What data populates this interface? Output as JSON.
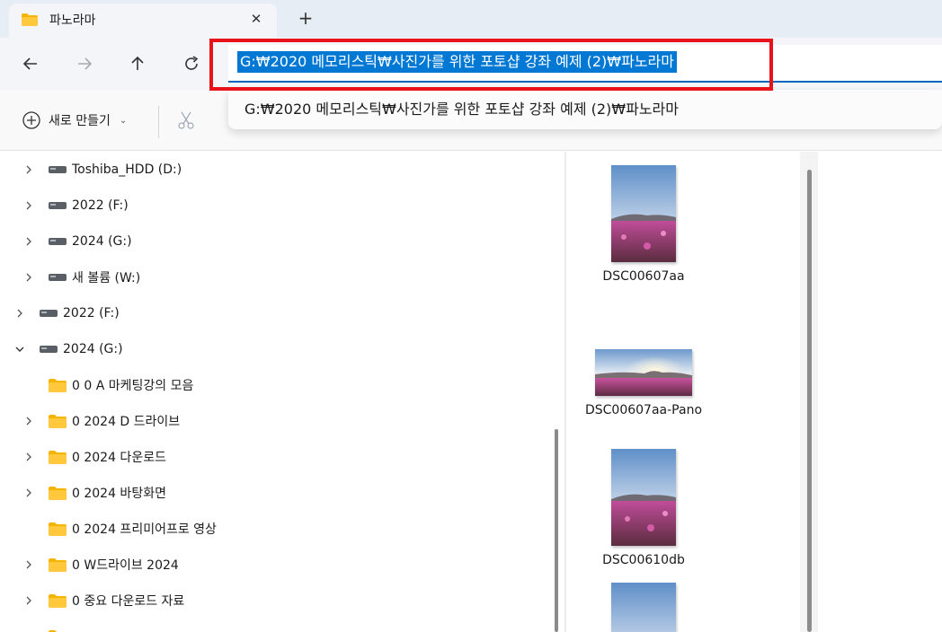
{
  "tab": {
    "title": "파노라마",
    "close_icon": "close-icon",
    "new_tab_icon": "plus-icon"
  },
  "nav": {
    "back_icon": "arrow-left-icon",
    "forward_icon": "arrow-right-icon",
    "up_icon": "arrow-up-icon",
    "refresh_icon": "refresh-icon"
  },
  "address": {
    "value": "G:₩2020 메모리스틱₩사진가를 위한 포토샵 강좌 예제 (2)₩파노라마",
    "suggestion": "G:₩2020 메모리스틱₩사진가를 위한 포토샵 강좌 예제 (2)₩파노라마"
  },
  "command": {
    "new_label": "새로 만들기",
    "cut_icon": "scissors-icon"
  },
  "tree": [
    {
      "label": "Toshiba_HDD (D:)",
      "type": "drive"
    },
    {
      "label": "2022 (F:)",
      "type": "drive"
    },
    {
      "label": "2024 (G:)",
      "type": "drive"
    },
    {
      "label": "새 볼륨 (W:)",
      "type": "drive"
    },
    {
      "label": "2022 (F:)",
      "type": "drive"
    },
    {
      "label": "2024 (G:)",
      "type": "drive",
      "expanded": true
    },
    {
      "label": "0 0  A 마케팅강의 모음",
      "type": "folder"
    },
    {
      "label": "0 2024 D 드라이브",
      "type": "folder"
    },
    {
      "label": "0 2024 다운로드",
      "type": "folder"
    },
    {
      "label": "0 2024 바탕화면",
      "type": "folder"
    },
    {
      "label": "0 2024 프리미어프로 영상",
      "type": "folder"
    },
    {
      "label": "0 W드라이브 2024",
      "type": "folder"
    },
    {
      "label": "0 중요 다운로드 자료",
      "type": "folder"
    }
  ],
  "files": [
    {
      "name": "DSC00607aa",
      "orientation": "portrait"
    },
    {
      "name": "DSC00607aa-Pano",
      "orientation": "landscape"
    },
    {
      "name": "DSC00610db",
      "orientation": "portrait"
    }
  ]
}
